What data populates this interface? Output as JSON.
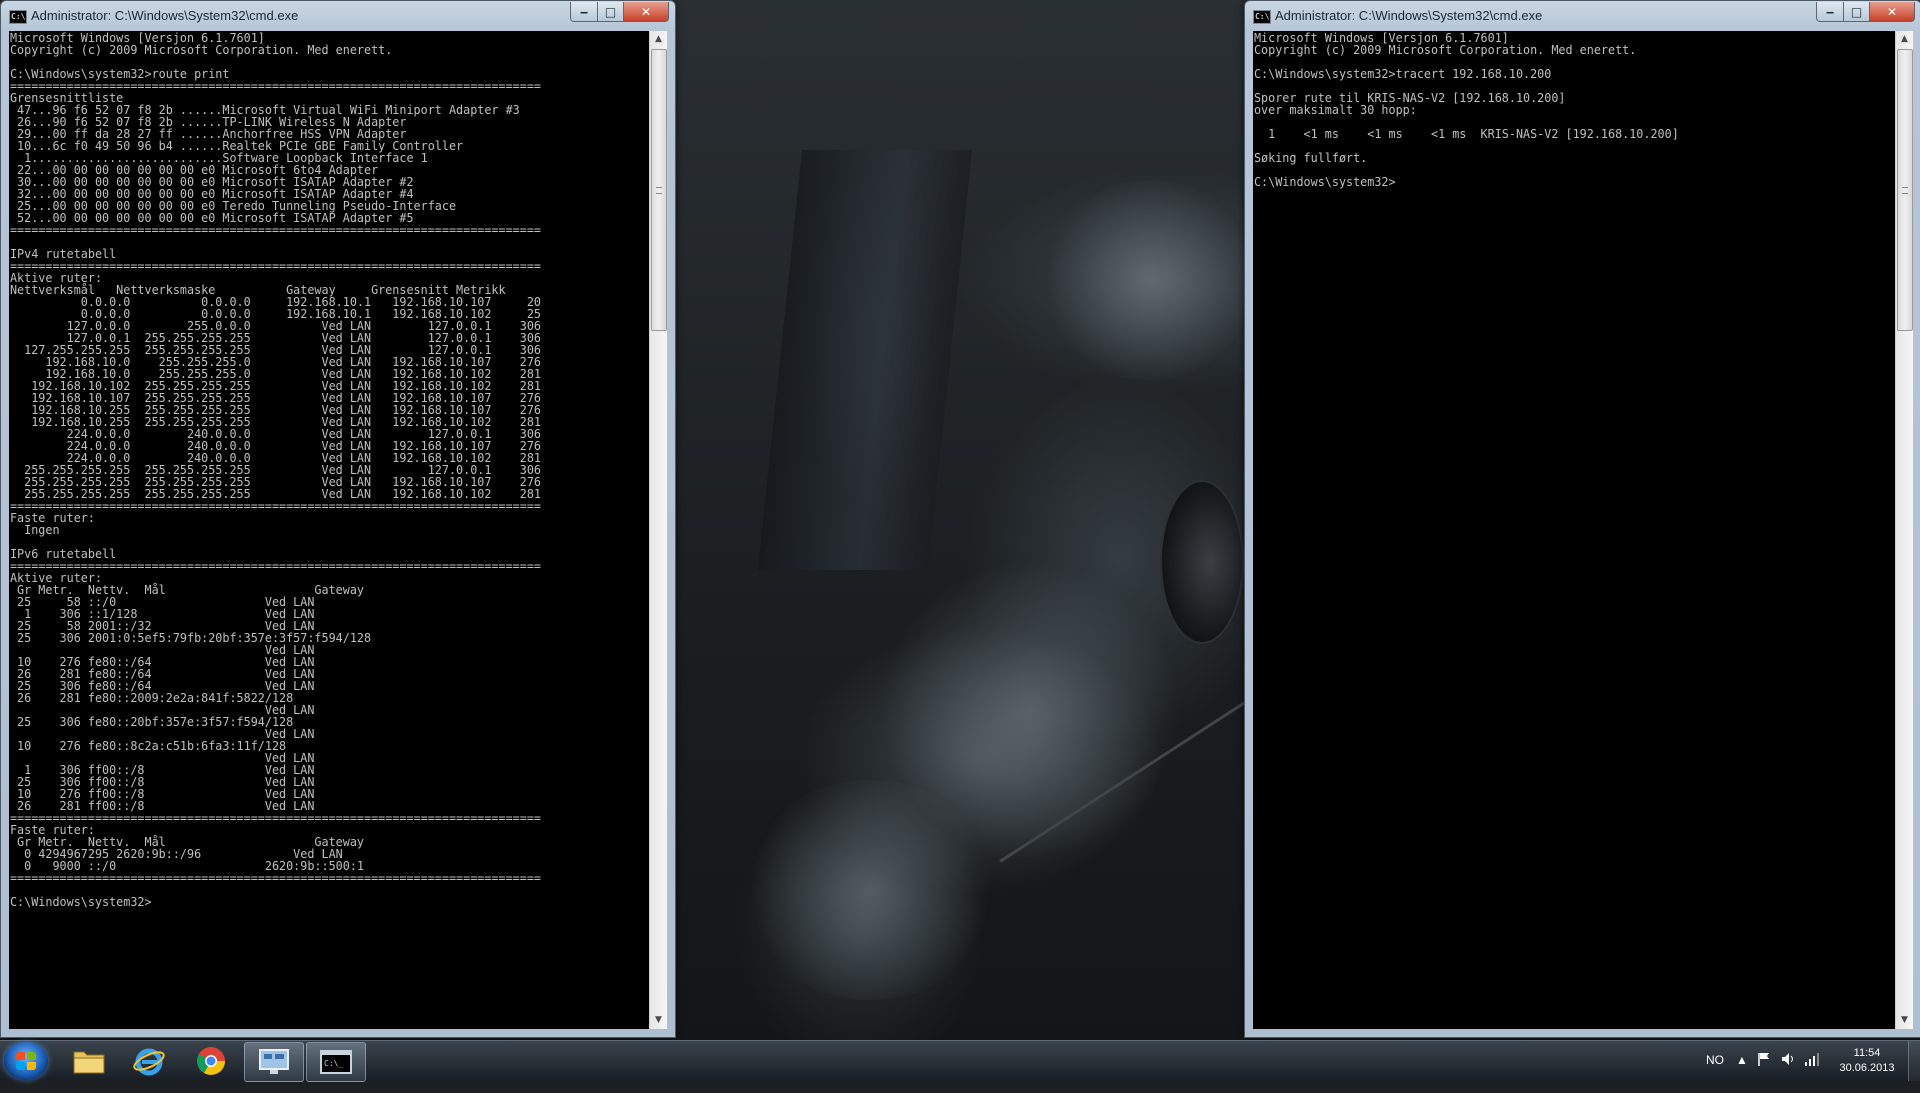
{
  "left_window": {
    "title": "Administrator: C:\\Windows\\System32\\cmd.exe",
    "console_text": "Microsoft Windows [Versjon 6.1.7601]\nCopyright (c) 2009 Microsoft Corporation. Med enerett.\n\nC:\\Windows\\system32>route print\n===========================================================================\nGrensesnittliste\n 47...96 f6 52 07 f8 2b ......Microsoft Virtual WiFi Miniport Adapter #3\n 26...90 f6 52 07 f8 2b ......TP-LINK Wireless N Adapter\n 29...00 ff da 28 27 ff ......Anchorfree HSS VPN Adapter\n 10...6c f0 49 50 96 b4 ......Realtek PCIe GBE Family Controller\n  1...........................Software Loopback Interface 1\n 22...00 00 00 00 00 00 00 e0 Microsoft 6to4 Adapter\n 30...00 00 00 00 00 00 00 e0 Microsoft ISATAP Adapter #2\n 32...00 00 00 00 00 00 00 e0 Microsoft ISATAP Adapter #4\n 25...00 00 00 00 00 00 00 e0 Teredo Tunneling Pseudo-Interface\n 52...00 00 00 00 00 00 00 e0 Microsoft ISATAP Adapter #5\n===========================================================================\n\nIPv4 rutetabell\n===========================================================================\nAktive ruter:\nNettverksmål   Nettverksmaske          Gateway     Grensesnitt Metrikk\n          0.0.0.0          0.0.0.0     192.168.10.1   192.168.10.107     20\n          0.0.0.0          0.0.0.0     192.168.10.1   192.168.10.102     25\n        127.0.0.0        255.0.0.0          Ved LAN        127.0.0.1    306\n        127.0.0.1  255.255.255.255          Ved LAN        127.0.0.1    306\n  127.255.255.255  255.255.255.255          Ved LAN        127.0.0.1    306\n     192.168.10.0    255.255.255.0          Ved LAN   192.168.10.107    276\n     192.168.10.0    255.255.255.0          Ved LAN   192.168.10.102    281\n   192.168.10.102  255.255.255.255          Ved LAN   192.168.10.102    281\n   192.168.10.107  255.255.255.255          Ved LAN   192.168.10.107    276\n   192.168.10.255  255.255.255.255          Ved LAN   192.168.10.107    276\n   192.168.10.255  255.255.255.255          Ved LAN   192.168.10.102    281\n        224.0.0.0        240.0.0.0          Ved LAN        127.0.0.1    306\n        224.0.0.0        240.0.0.0          Ved LAN   192.168.10.107    276\n        224.0.0.0        240.0.0.0          Ved LAN   192.168.10.102    281\n  255.255.255.255  255.255.255.255          Ved LAN        127.0.0.1    306\n  255.255.255.255  255.255.255.255          Ved LAN   192.168.10.107    276\n  255.255.255.255  255.255.255.255          Ved LAN   192.168.10.102    281\n===========================================================================\nFaste ruter:\n  Ingen\n\nIPv6 rutetabell\n===========================================================================\nAktive ruter:\n Gr Metr.  Nettv.  Mål                     Gateway\n 25     58 ::/0                     Ved LAN\n  1    306 ::1/128                  Ved LAN\n 25     58 2001::/32                Ved LAN\n 25    306 2001:0:5ef5:79fb:20bf:357e:3f57:f594/128\n                                    Ved LAN\n 10    276 fe80::/64                Ved LAN\n 26    281 fe80::/64                Ved LAN\n 25    306 fe80::/64                Ved LAN\n 26    281 fe80::2009:2e2a:841f:5822/128\n                                    Ved LAN\n 25    306 fe80::20bf:357e:3f57:f594/128\n                                    Ved LAN\n 10    276 fe80::8c2a:c51b:6fa3:11f/128\n                                    Ved LAN\n  1    306 ff00::/8                 Ved LAN\n 25    306 ff00::/8                 Ved LAN\n 10    276 ff00::/8                 Ved LAN\n 26    281 ff00::/8                 Ved LAN\n===========================================================================\nFaste ruter:\n Gr Metr.  Nettv.  Mål                     Gateway\n  0 4294967295 2620:9b::/96             Ved LAN\n  0   9000 ::/0                     2620:9b::500:1\n===========================================================================\n\nC:\\Windows\\system32>"
  },
  "right_window": {
    "title": "Administrator: C:\\Windows\\System32\\cmd.exe",
    "console_text": "Microsoft Windows [Versjon 6.1.7601]\nCopyright (c) 2009 Microsoft Corporation. Med enerett.\n\nC:\\Windows\\system32>tracert 192.168.10.200\n\nSporer rute til KRIS-NAS-V2 [192.168.10.200]\nover maksimalt 30 hopp:\n\n  1    <1 ms    <1 ms    <1 ms  KRIS-NAS-V2 [192.168.10.200]\n\nSøking fullført.\n\nC:\\Windows\\system32>"
  },
  "window_controls": {
    "minimize": "‒",
    "maximize": "□",
    "close": "✕"
  },
  "taskbar": {
    "pinned": [
      {
        "name": "windows-explorer",
        "icon": "folder-icon"
      },
      {
        "name": "internet-explorer",
        "icon": "ie-icon"
      },
      {
        "name": "google-chrome",
        "icon": "chrome-icon"
      },
      {
        "name": "remote-desktop",
        "icon": "monitor-icon"
      },
      {
        "name": "command-prompt",
        "icon": "console-icon",
        "active": true
      }
    ],
    "language": "NO",
    "time": "11:54",
    "date": "30.06.2013"
  },
  "colors": {
    "console_bg": "#000000",
    "console_fg": "#c0c0c0",
    "title_bar": "#b6c6d6",
    "close_button": "#c7412a"
  }
}
